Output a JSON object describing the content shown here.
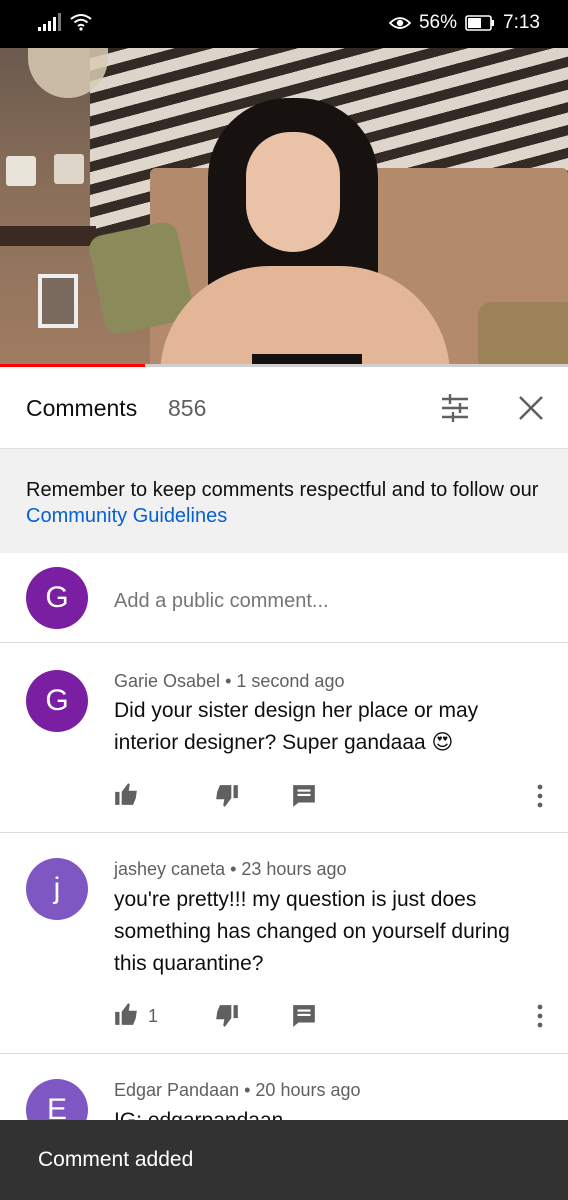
{
  "status_bar": {
    "battery": "56%",
    "time": "7:13"
  },
  "video": {
    "progress_fraction": 0.255
  },
  "comments_panel": {
    "title": "Comments",
    "count": "856"
  },
  "notice": {
    "text": "Remember to keep comments respectful and to follow our ",
    "link": "Community Guidelines"
  },
  "add_comment": {
    "avatar_letter": "G",
    "avatar_color": "#7b1fa2",
    "placeholder": "Add a public comment..."
  },
  "comments": [
    {
      "avatar_letter": "G",
      "avatar_color": "#7b1fa2",
      "author": "Garie Osabel",
      "time": "1 second ago",
      "text": "Did your sister design her place or may interior designer? Super gandaaa 😍",
      "likes": ""
    },
    {
      "avatar_letter": "j",
      "avatar_color": "#7e57c2",
      "author": "jashey caneta",
      "time": "23 hours ago",
      "text": "you're pretty!!! my question is just does something has changed on yourself during this quarantine?",
      "likes": "1"
    },
    {
      "avatar_letter": "E",
      "avatar_color": "#7e57c2",
      "author": "Edgar Pandaan",
      "time": "20 hours ago",
      "text": "IG: edgarpandaan"
    }
  ],
  "snackbar": {
    "text": "Comment added"
  }
}
